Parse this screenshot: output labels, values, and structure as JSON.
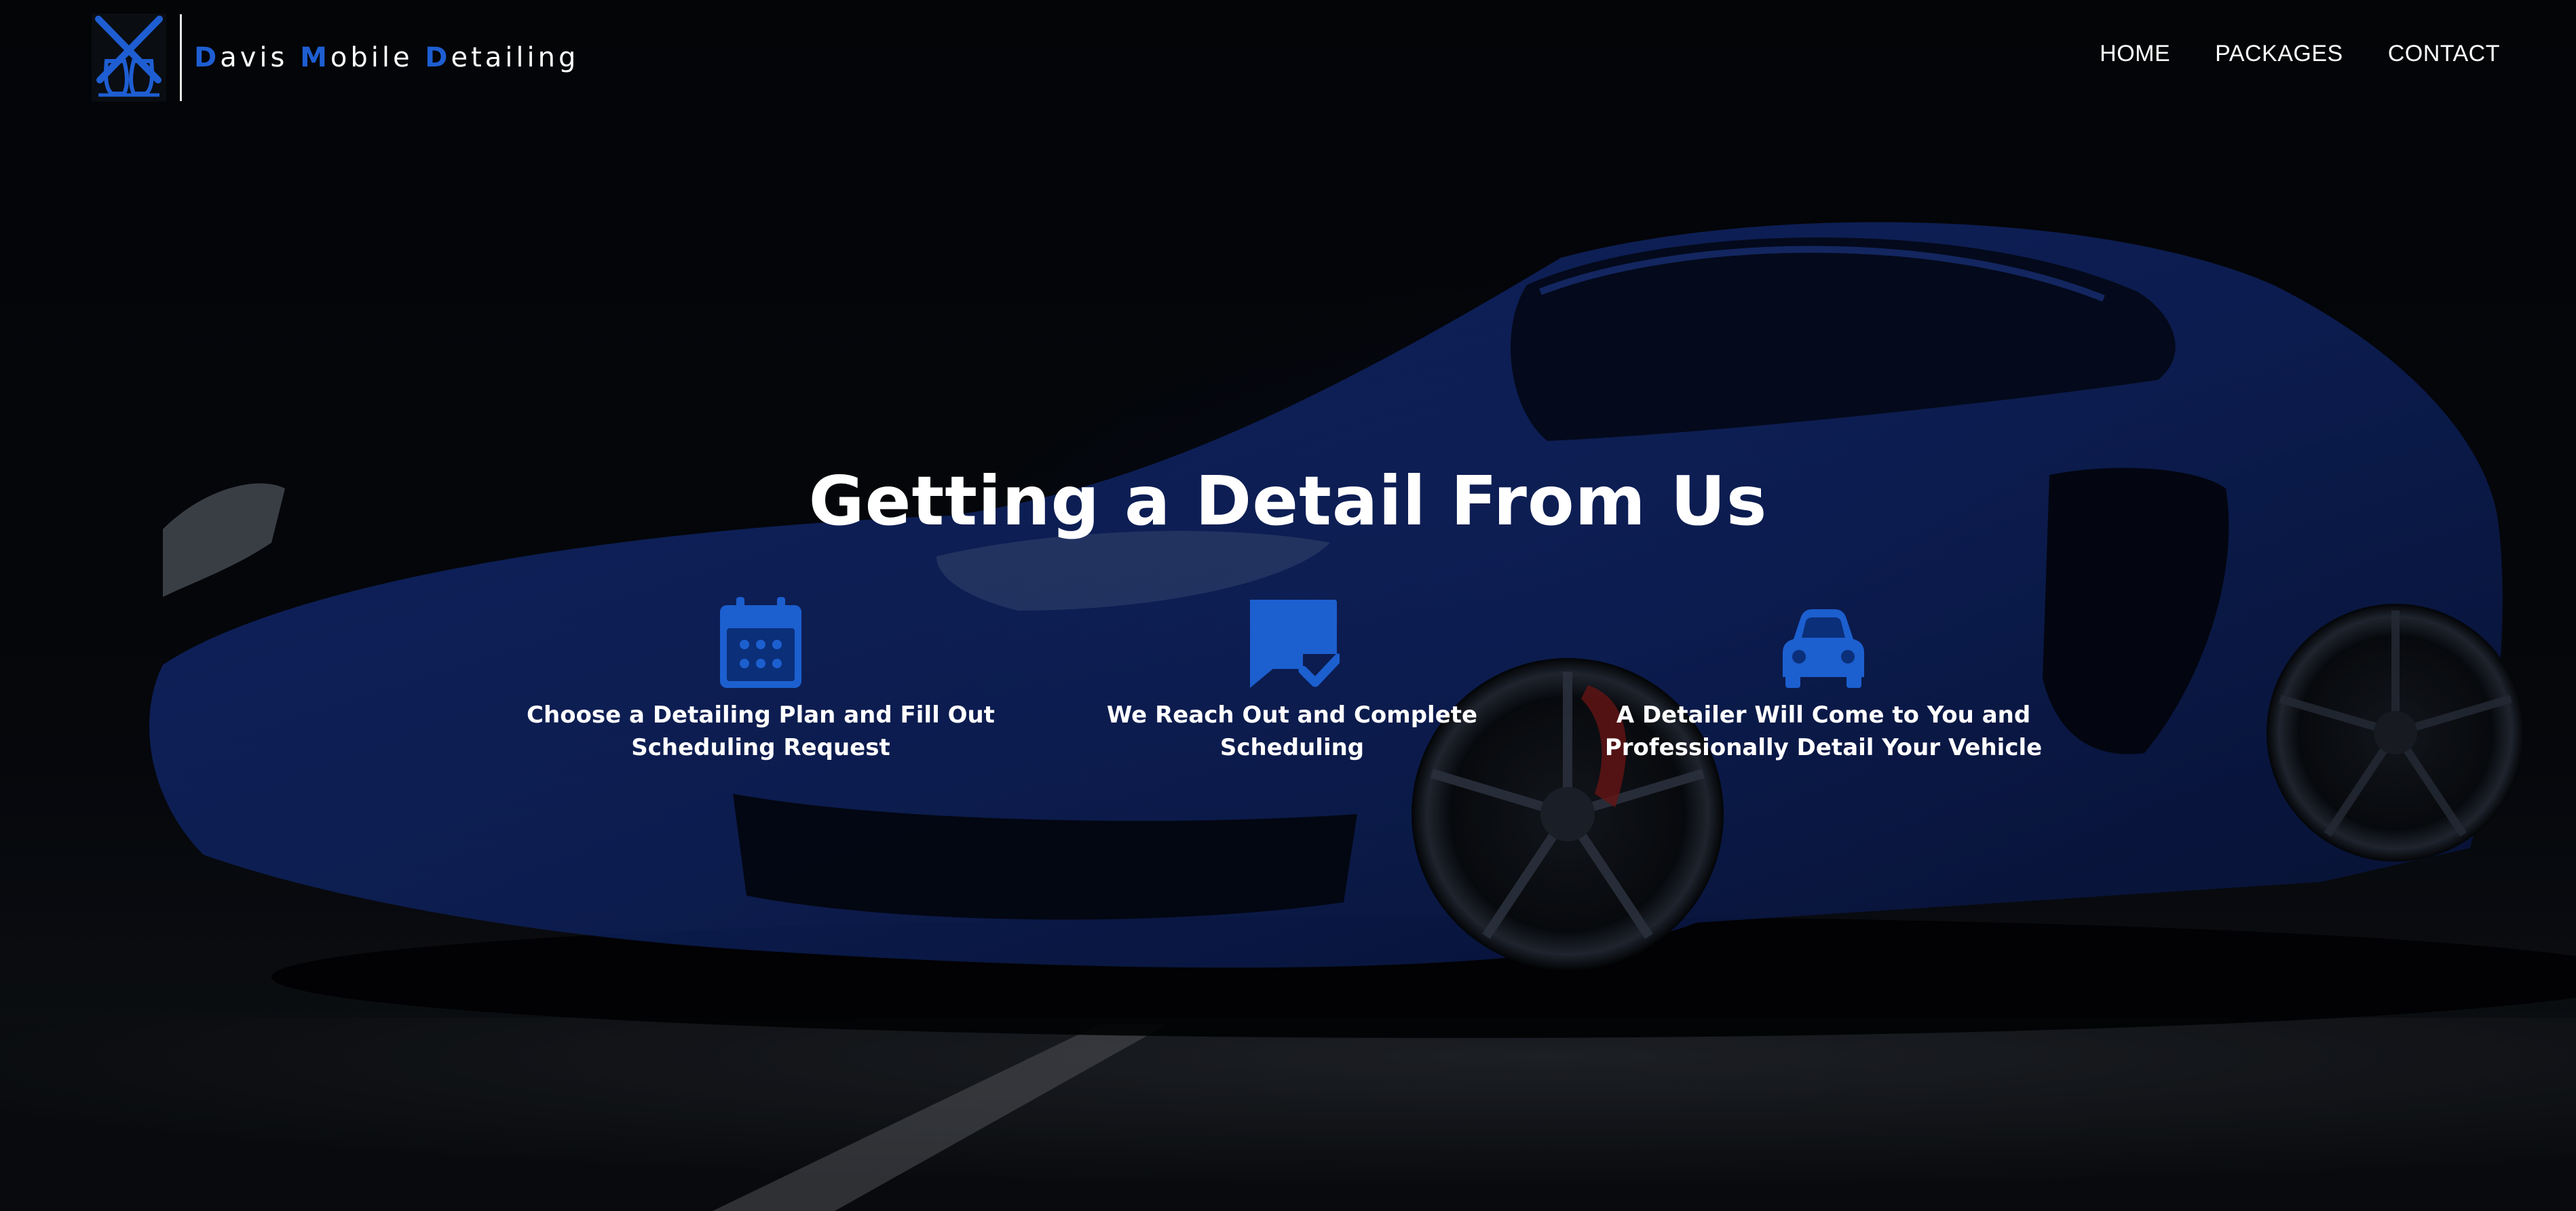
{
  "brand": {
    "name_parts": [
      {
        "cap": "D",
        "rest": "avis "
      },
      {
        "cap": "M",
        "rest": "obile "
      },
      {
        "cap": "D",
        "rest": "etailing"
      }
    ],
    "accent_color": "#1e5ed2",
    "logo_icon": "crossed-spray-bottles-logo"
  },
  "nav": {
    "items": [
      "HOME",
      "PACKAGES",
      "CONTACT"
    ]
  },
  "main": {
    "title": "Getting a Detail From Us",
    "steps": [
      {
        "icon": "calendar-icon",
        "label": "Choose a Detailing Plan and Fill Out\nScheduling Request"
      },
      {
        "icon": "message-check-icon",
        "label": "We Reach Out and Complete Scheduling"
      },
      {
        "icon": "car-icon",
        "label": "A Detailer Will Come to You and\nProfessionally Detail Your Vehicle"
      }
    ]
  },
  "colors": {
    "icon_blue": "#1c5fcf",
    "text": "#ffffff",
    "background": "#06090d",
    "car_blue": "#16308c"
  }
}
